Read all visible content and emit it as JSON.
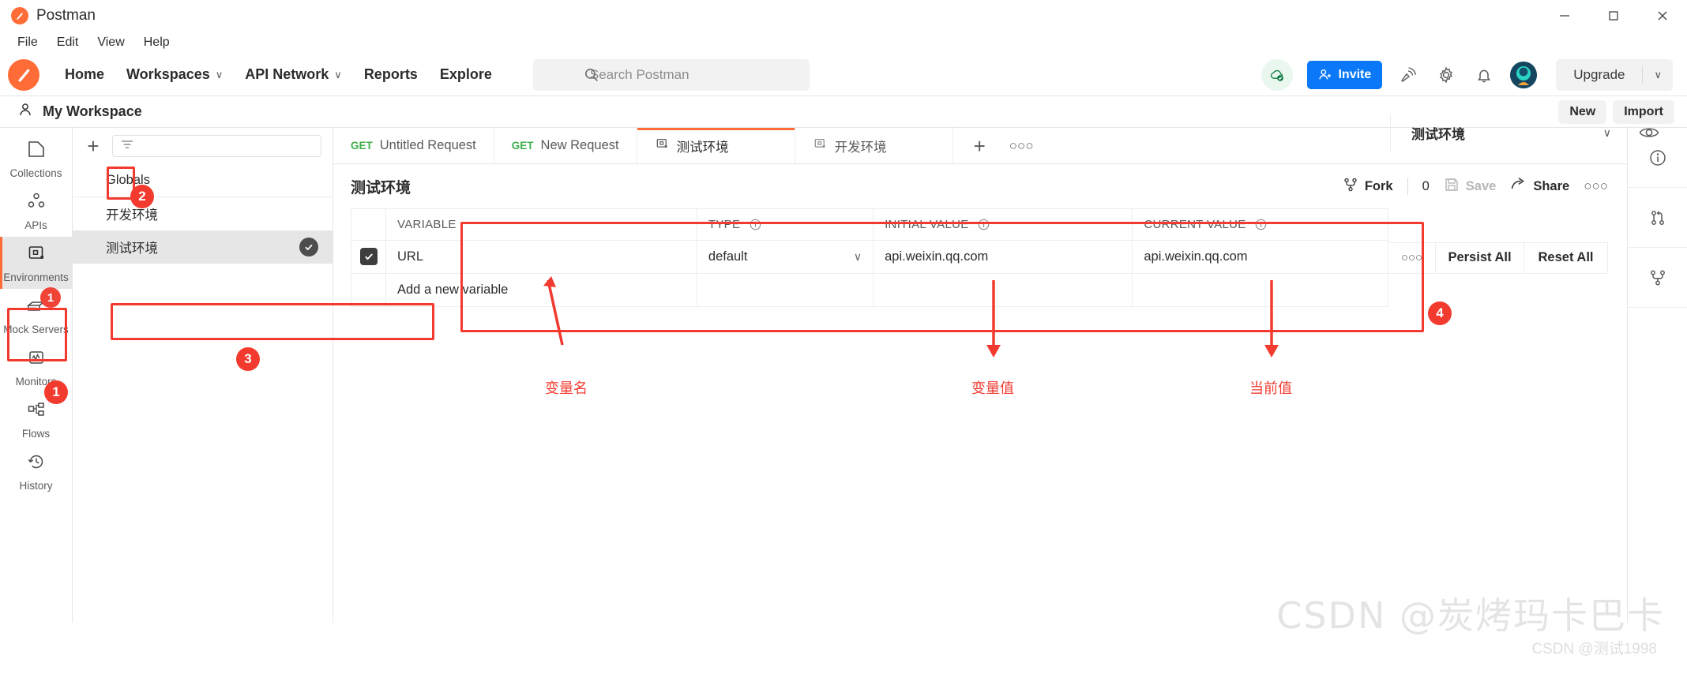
{
  "window": {
    "app_title": "Postman",
    "minimize": "─",
    "maximize": "☐",
    "close": "✕"
  },
  "menubar": {
    "items": [
      "File",
      "Edit",
      "View",
      "Help"
    ]
  },
  "toolbar": {
    "nav": [
      {
        "label": "Home",
        "caret": ""
      },
      {
        "label": "Workspaces",
        "caret": "∨"
      },
      {
        "label": "API Network",
        "caret": "∨"
      },
      {
        "label": "Reports",
        "caret": ""
      },
      {
        "label": "Explore",
        "caret": ""
      }
    ],
    "search_placeholder": "Search Postman",
    "invite_label": "Invite",
    "upgrade_label": "Upgrade",
    "upgrade_caret": "∨"
  },
  "workspace_bar": {
    "name": "My Workspace",
    "new_label": "New",
    "import_label": "Import"
  },
  "sidebar": {
    "items": [
      {
        "label": "Collections",
        "icon": "collections-icon",
        "active": false,
        "badge": ""
      },
      {
        "label": "APIs",
        "icon": "apis-icon",
        "active": false,
        "badge": ""
      },
      {
        "label": "Environments",
        "icon": "environments-icon",
        "active": true,
        "badge": ""
      },
      {
        "label": "Mock Servers",
        "icon": "mock-servers-icon",
        "active": false,
        "badge": "1"
      },
      {
        "label": "Monitors",
        "icon": "monitors-icon",
        "active": false,
        "badge": ""
      },
      {
        "label": "Flows",
        "icon": "flows-icon",
        "active": false,
        "badge": ""
      },
      {
        "label": "History",
        "icon": "history-icon",
        "active": false,
        "badge": ""
      }
    ]
  },
  "env_panel": {
    "filter_placeholder": "",
    "rows": [
      {
        "label": "Globals",
        "selected": false,
        "active": false
      },
      {
        "label": "开发环境",
        "selected": false,
        "active": false
      },
      {
        "label": "测试环境",
        "selected": true,
        "active": true
      }
    ]
  },
  "tabs": [
    {
      "method": "GET",
      "label": "Untitled Request",
      "icon": "",
      "active": false
    },
    {
      "method": "GET",
      "label": "New Request",
      "icon": "",
      "active": false
    },
    {
      "method": "",
      "label": "测试环境",
      "icon": "environment-icon",
      "active": true
    },
    {
      "method": "",
      "label": "开发环境",
      "icon": "environment-icon",
      "active": false
    }
  ],
  "env_selector": {
    "current": "测试环境",
    "caret": "∨"
  },
  "env_header": {
    "title": "测试环境",
    "fork_label": "Fork",
    "fork_count": "0",
    "save_label": "Save",
    "share_label": "Share",
    "more_label": "○○○"
  },
  "vars_table": {
    "columns": [
      "VARIABLE",
      "TYPE",
      "INITIAL VALUE",
      "CURRENT VALUE"
    ],
    "rows": [
      {
        "checked": true,
        "variable": "URL",
        "type": "default",
        "initial_value": "api.weixin.qq.com",
        "current_value": "api.weixin.qq.com",
        "placeholder": false
      },
      {
        "checked": false,
        "variable": "Add a new variable",
        "type": "",
        "initial_value": "",
        "current_value": "",
        "placeholder": true
      }
    ],
    "persist_all": "Persist All",
    "reset_all": "Reset All",
    "more": "○○○"
  },
  "annotations": {
    "numbers": [
      "1",
      "2",
      "3",
      "4"
    ],
    "labels": [
      {
        "text": "变量名"
      },
      {
        "text": "变量值"
      },
      {
        "text": "当前值"
      }
    ],
    "accent_color": "#f23a2f"
  },
  "watermark": {
    "line1": "CSDN @炭烤玛卡巴卡",
    "line2": "CSDN @测试1998"
  },
  "colors": {
    "brand_orange": "#ff6c37",
    "invite_blue": "#0b79f7",
    "method_green": "#3faf4c",
    "annotation_red": "#f23a2f"
  }
}
